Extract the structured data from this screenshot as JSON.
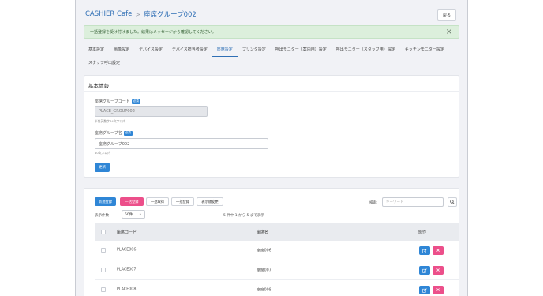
{
  "breadcrumb": {
    "app": "CASHIER Cafe",
    "separator": ">",
    "current": "座席グループ002"
  },
  "header": {
    "back_label": "戻る"
  },
  "alert": {
    "message": "一括登録を受け付けました。結果はメッセージから確認してください。",
    "close": "×"
  },
  "tabs": [
    {
      "label": "基本設定"
    },
    {
      "label": "画像設定"
    },
    {
      "label": "デバイス設定"
    },
    {
      "label": "デバイス担当者設定"
    },
    {
      "label": "座席設定",
      "active": true
    },
    {
      "label": "プリンタ設定"
    },
    {
      "label": "呼出モニター（案内用）設定"
    },
    {
      "label": "呼出モニター（スタッフ用）設定"
    },
    {
      "label": "キッチンモニター設定"
    },
    {
      "label": "スタッフ呼出設定"
    }
  ],
  "basic_info": {
    "title": "基本情報",
    "code_label": "座席グループコード",
    "code_required": "必須",
    "code_value": "PLACE_GROUP002",
    "code_hint": "半角英数字64文字以内",
    "name_label": "座席グループ名",
    "name_required": "必須",
    "name_value": "座席グループ002",
    "name_hint": "40文字以内",
    "update_label": "更新"
  },
  "toolbar": {
    "new_label": "新規登録",
    "bulk_register_label": "一括登録",
    "bulk_get_label": "一括取得",
    "bulk_update_label": "一括登録",
    "order_label": "表示順変更",
    "search_label": "検索:",
    "search_placeholder": "キーワード"
  },
  "list": {
    "count_label": "表示件数",
    "per_page": "50件",
    "paging": "5 件中 1 から 5 まで表示",
    "columns": {
      "code": "座席コード",
      "name": "座席名",
      "actions": "操作"
    },
    "rows": [
      {
        "code": "PLACE006",
        "name": "座席006"
      },
      {
        "code": "PLACE007",
        "name": "座席007"
      },
      {
        "code": "PLACE008",
        "name": "座席008"
      }
    ]
  }
}
